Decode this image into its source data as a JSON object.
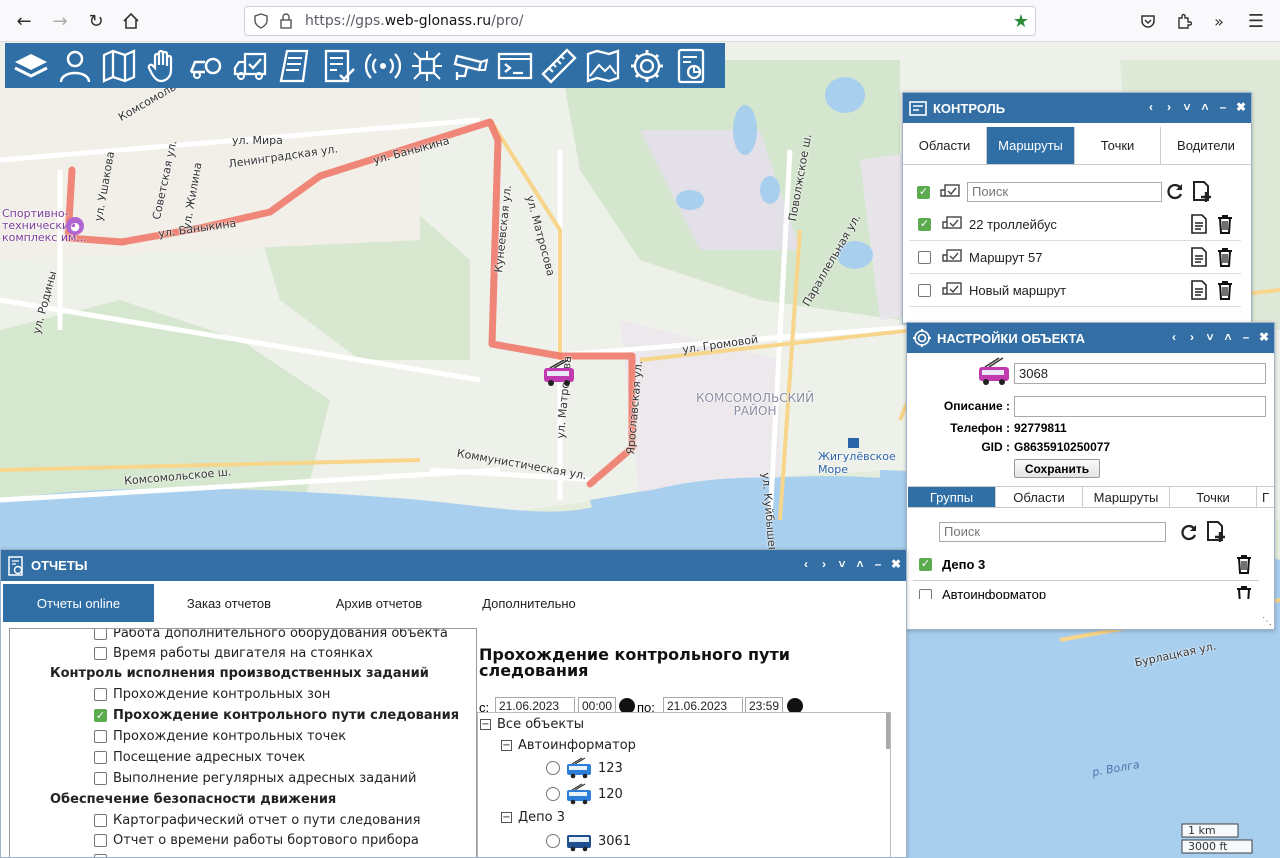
{
  "browser": {
    "url_scheme": "https://gps.",
    "url_host": "web-glonass.ru",
    "url_path": "/pro/"
  },
  "toolbar": {
    "icons": [
      "layers-icon",
      "user-icon",
      "map-icon",
      "hand-icon",
      "car-settings-icon",
      "truck-check-icon",
      "document-icon",
      "checklist-icon",
      "signal-icon",
      "network-icon",
      "camera-icon",
      "terminal-icon",
      "ruler-icon",
      "map-image-icon",
      "gear-icon",
      "report-icon"
    ]
  },
  "map": {
    "labels": {
      "sport_complex": "Спортивно-\nтехнический\nкомплекс им...",
      "ul_mira": "ул. Мира",
      "ul_leningradskaya": "Ленинградская ул.",
      "ul_banykina_1": "ул. Баныкина",
      "ul_banykina_2": "ул. Баныкина",
      "ul_ushakova": "ул. Ушакова",
      "ul_zhilina": "ул. Жилина",
      "sovetskaya": "Советская ул.",
      "komsomolskaya": "Комсомольская ул.",
      "ul_rodiny": "ул. Родины",
      "kuneevskaya": "Кунеевская ул.",
      "ul_matrosova_1": "ул. Матросова",
      "ul_matrosova_2": "ул. Матросова",
      "ul_gromovoy": "ул. Громовой",
      "yaroslavskaya": "Ярославская ул.",
      "komsomolsky_rayon": "КОМСОМОЛЬСКИЙ\nРАЙОН",
      "zhigulevskoe_more": "Жигулёвское\nМоре",
      "kommunisticheskaya": "Коммунистическая ул.",
      "komsomolskoe_sh": "Комсомольское ш.",
      "povolzhskoe_sh": "Поволжское ш.",
      "ul_kuybysheva": "ул. Куйбышева",
      "parallelnaya": "Параллельная ул.",
      "burlatskaya": "Бурлацкая ул.",
      "r_volga": "р. Волга",
      "scale_km": "1 km",
      "scale_ft": "3000 ft"
    }
  },
  "control_panel": {
    "title": "КОНТРОЛЬ",
    "tabs": [
      "Области",
      "Маршруты",
      "Точки",
      "Водители"
    ],
    "active_tab": "Маршруты",
    "search_placeholder": "Поиск",
    "routes": [
      {
        "name": "22 троллейбус",
        "checked": true
      },
      {
        "name": "Маршрут 57",
        "checked": false
      },
      {
        "name": "Новый маршрут",
        "checked": false
      }
    ]
  },
  "object_settings": {
    "title": "НАСТРОЙКИ ОБЪЕКТА",
    "name_value": "3068",
    "description_label": "Описание :",
    "description_value": "",
    "phone_label": "Телефон :",
    "phone_value": "92779811",
    "gid_label": "GID :",
    "gid_value": "G8635910250077",
    "save_label": "Сохранить",
    "tabs": [
      "Группы",
      "Области",
      "Маршруты",
      "Точки",
      "Г"
    ],
    "active_tab": "Группы",
    "search_placeholder": "Поиск",
    "groups": [
      {
        "name": "Депо 3",
        "checked": true
      },
      {
        "name": "Автоинформатор",
        "checked": false
      }
    ]
  },
  "reports_panel": {
    "title": "ОТЧЕТЫ",
    "tabs": [
      "Отчеты online",
      "Заказ отчетов",
      "Архив отчетов",
      "Дополнительно"
    ],
    "active_tab": "Отчеты online",
    "report_list": [
      {
        "text": "Работа дополнительного оборудования объекта",
        "type": "item",
        "checked": false
      },
      {
        "text": "Время работы двигателя на стоянках",
        "type": "item",
        "checked": false
      },
      {
        "text": "Контроль исполнения производственных заданий",
        "type": "group"
      },
      {
        "text": "Прохождение контрольных зон",
        "type": "item",
        "checked": false
      },
      {
        "text": "Прохождение контрольного пути следования",
        "type": "item",
        "checked": true
      },
      {
        "text": "Прохождение контрольных точек",
        "type": "item",
        "checked": false
      },
      {
        "text": "Посещение адресных точек",
        "type": "item",
        "checked": false
      },
      {
        "text": "Выполнение регулярных адресных заданий",
        "type": "item",
        "checked": false
      },
      {
        "text": "Обеспечение безопасности движения",
        "type": "group"
      },
      {
        "text": "Картографический отчет о пути следования",
        "type": "item",
        "checked": false
      },
      {
        "text": "Отчет о времени работы бортового прибора",
        "type": "item",
        "checked": false
      }
    ],
    "report_title": "Прохождение контрольного пути следования",
    "from_label": "с:",
    "from_date": "21.06.2023",
    "from_time": "00:00",
    "to_label": "по:",
    "to_date": "21.06.2023",
    "to_time": "23:59",
    "tree": {
      "root": "Все объекты",
      "groups": [
        {
          "name": "Автоинформатор",
          "objects": [
            "123",
            "120"
          ]
        },
        {
          "name": "Депо 3",
          "objects": [
            "3061"
          ]
        }
      ]
    }
  }
}
